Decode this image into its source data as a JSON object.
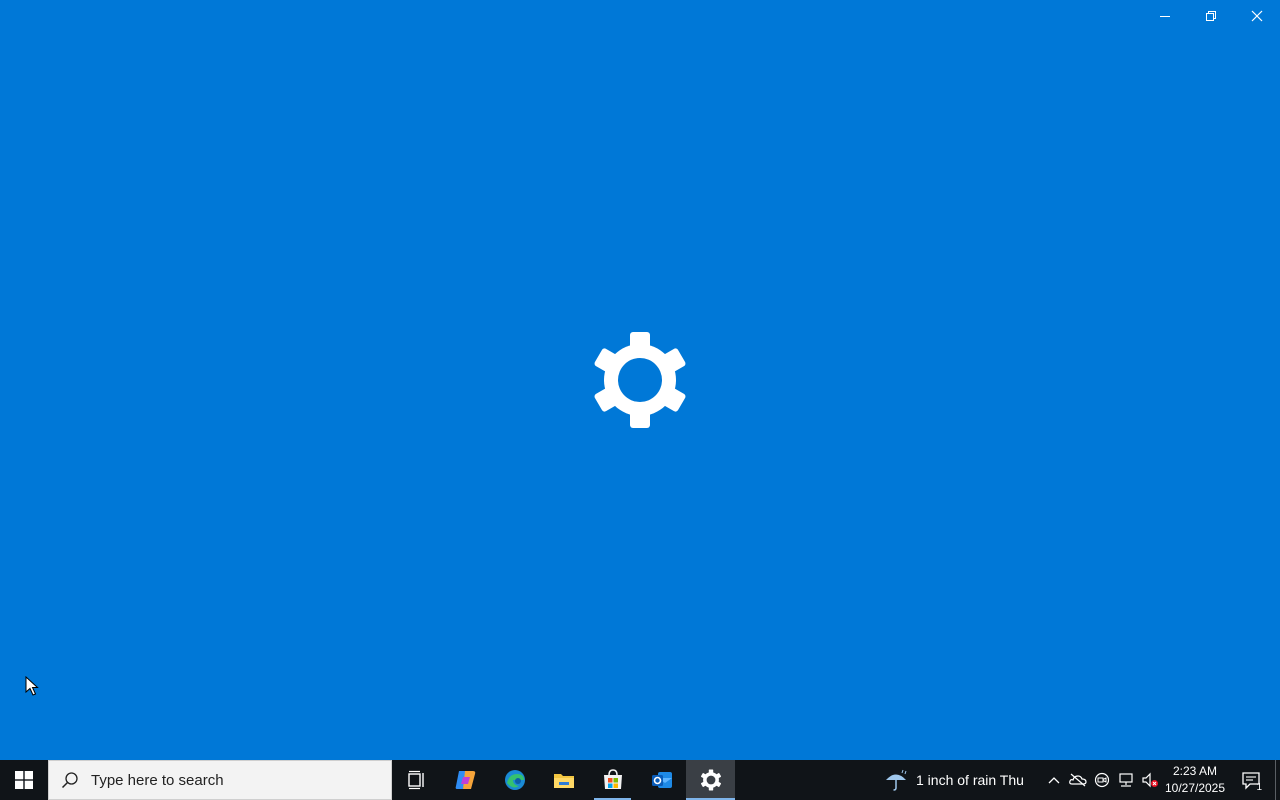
{
  "window": {
    "title": "Settings",
    "controls": [
      "minimize",
      "restore",
      "close"
    ],
    "splash_icon": "gear-icon",
    "background": "#0078d7"
  },
  "taskbar": {
    "search": {
      "placeholder": "Type here to search"
    },
    "apps": [
      {
        "name": "task-view-icon",
        "running": false
      },
      {
        "name": "copilot-icon",
        "running": false
      },
      {
        "name": "edge-icon",
        "running": false
      },
      {
        "name": "file-explorer-icon",
        "running": false
      },
      {
        "name": "microsoft-store-icon",
        "running": true
      },
      {
        "name": "outlook-icon",
        "running": false
      },
      {
        "name": "settings-icon",
        "running": true,
        "active": true
      }
    ],
    "weather": {
      "text": "1 inch of rain Thu",
      "icon": "umbrella-rain-icon"
    },
    "tray_icons": [
      "chevron-up-icon",
      "onedrive-icon",
      "meet-now-icon",
      "network-icon",
      "volume-muted-icon"
    ],
    "clock": {
      "time": "2:23 AM",
      "date": "10/27/2025"
    },
    "notifications": {
      "count": "1"
    }
  }
}
